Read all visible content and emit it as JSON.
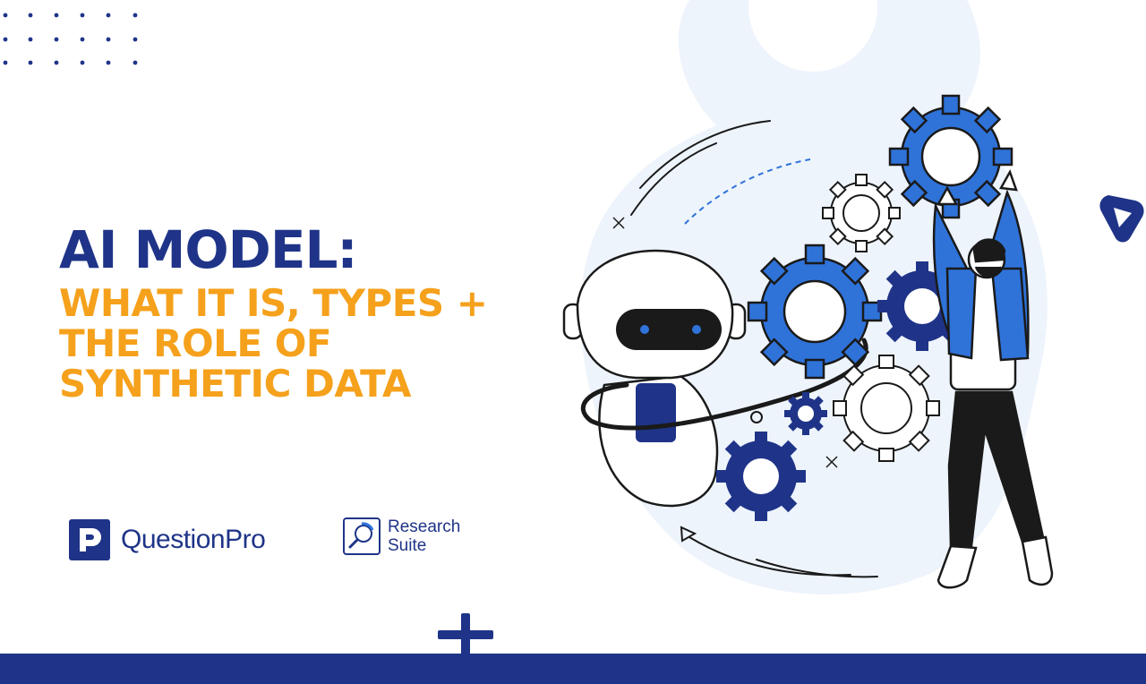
{
  "title": {
    "main": "AI MODEL:",
    "subtitle_lines": [
      "WHAT IT IS, TYPES +",
      "THE ROLE OF",
      "SYNTHETIC DATA"
    ]
  },
  "logos": {
    "questionpro": "QuestionPro",
    "research_suite_line1": "Research",
    "research_suite_line2": "Suite"
  },
  "colors": {
    "navy": "#1f3488",
    "orange": "#f5a11c",
    "gear_blue": "#2f73d9",
    "background_blob": "#eef4fc",
    "bottom_bar": "#1f3488"
  },
  "icons": [
    "dot-grid",
    "robot-illustration",
    "gear-icon",
    "person-illustration",
    "plus-icon",
    "play-triangle-icon",
    "questionpro-logo-icon",
    "research-suite-logo-icon"
  ]
}
